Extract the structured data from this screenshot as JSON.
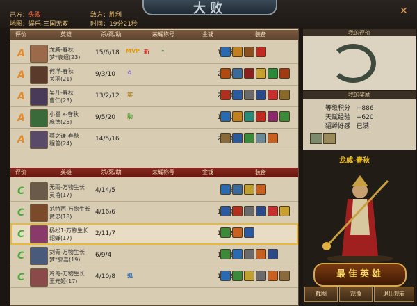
{
  "top": {
    "own_label": "己方：",
    "own_value": "失败",
    "enemy_label": "敌方：",
    "enemy_value": "胜利",
    "map_label": "地图：",
    "map_value": "娱乐-三国无双",
    "time_label": "时间：",
    "time_value": "19分21秒",
    "banner": "大败"
  },
  "table_headers": [
    "评价",
    "英雄",
    "杀/死/助",
    "荣耀称号",
    "金钱",
    "装备"
  ],
  "team_win": [
    {
      "rating": "A",
      "name": "龙威-春秋",
      "hero": "梦*袁绍(23)",
      "kda": "15/6/18",
      "gold": "18559",
      "honors": [
        "MVP",
        "新"
      ]
    },
    {
      "rating": "A",
      "name": "何洋-春秋",
      "hero": "关羽(21)",
      "kda": "9/3/10",
      "gold": "20405",
      "honors": []
    },
    {
      "rating": "A",
      "name": "吴凡-春秋",
      "hero": "曹仁(23)",
      "kda": "13/2/12",
      "gold": "23103",
      "honors": [
        "实"
      ]
    },
    {
      "rating": "A",
      "name": "小瞿 x-春秋",
      "hero": "庞德(25)",
      "kda": "9/5/20",
      "gold": "16118",
      "honors": [
        "助"
      ]
    },
    {
      "rating": "A",
      "name": "蔡之谦-春秋",
      "hero": "程普(24)",
      "kda": "14/5/16",
      "gold": "20507",
      "honors": []
    }
  ],
  "team_lose": [
    {
      "rating": "C",
      "name": "无雨-万物生长",
      "hero": "灵甫(17)",
      "kda": "4/14/5",
      "gold": "9567",
      "honors": []
    },
    {
      "rating": "C",
      "name": "范特西-万物生长",
      "hero": "黄忠(18)",
      "kda": "4/16/6",
      "gold": "15706",
      "honors": []
    },
    {
      "rating": "C",
      "name": "杨松1-万物生长",
      "hero": "貂蝉(17)",
      "kda": "2/11/7",
      "gold": "11521",
      "honors": []
    },
    {
      "rating": "C",
      "name": "剑青-万物生长",
      "hero": "梦*郭嘉(19)",
      "kda": "6/9/4",
      "gold": "13787",
      "honors": []
    },
    {
      "rating": "C",
      "name": "冷岛-万物生长",
      "hero": "王元姬(17)",
      "kda": "4/10/8",
      "gold": "14729",
      "honors": [
        "弧"
      ]
    }
  ],
  "right": {
    "my_rating_title": "我的评价",
    "my_reward_title": "我的奖励",
    "rewards": [
      {
        "label": "等级积分",
        "value": "+886"
      },
      {
        "label": "天赋经验",
        "value": "+620"
      },
      {
        "label": "貂蝉好感",
        "value": "已满"
      }
    ],
    "featured_name": "龙威-春秋",
    "best_hero": "最佳英雄",
    "buttons": [
      "截图",
      "观像",
      "退出观看"
    ]
  }
}
